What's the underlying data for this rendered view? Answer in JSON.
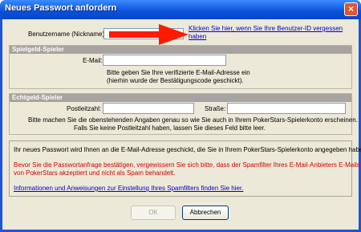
{
  "window": {
    "title": "Neues Passwort anfordern",
    "close_glyph": "×"
  },
  "username": {
    "label": "Benutzername (Nickname):",
    "value": "",
    "link_line1": "Klicken Sie hier, wenn Sie Ihre Benutzer-ID vergessen",
    "link_line2": "haben"
  },
  "spielgeld": {
    "header": "Spielgeld-Spieler",
    "email_label": "E-Mail:",
    "email_value": "",
    "hint_line1": "Bitte geben Sie Ihre verifizierte E-Mail-Adresse ein",
    "hint_line2": "(hierhin wurde der Bestätigungscode geschickt)."
  },
  "echtgeld": {
    "header": "Echtgeld-Spieler",
    "postleitzahl_label": "Postleitzahl:",
    "postleitzahl_value": "",
    "strasse_label": "Straße:",
    "strasse_value": "",
    "hint_line1": "Bitte machen Sie die obenstehenden Angaben genau so wie Sie auch in Ihrem PokerStars-Spielerkonto erscheinen.",
    "hint_line2": "Falls Sie keine Postleitzahl haben, lassen Sie dieses Feld bitte leer."
  },
  "info": {
    "line1": "Ihr neues Passwort wird Ihnen an die E-Mail-Adresse geschickt, die Sie in Ihrem PokerStars-Spielerkonto angegeben haben.",
    "warning_line1": "Bevor Sie die Passwortanfrage bestätigen, vergewissern Sie sich bitte, dass der Spamfilter Ihres E-Mail-Anbieters E-Mails",
    "warning_line2": "von PokerStars akzeptiert und nicht als Spam behandelt.",
    "spam_link": "Informationen und Anweisungen zur Einstellung Ihres Spamfilters finden Sie hier."
  },
  "buttons": {
    "ok": "OK",
    "cancel": "Abbrechen"
  },
  "colors": {
    "arrow": "#ff1a00",
    "warning": "#d40000",
    "link": "#0000cc"
  }
}
